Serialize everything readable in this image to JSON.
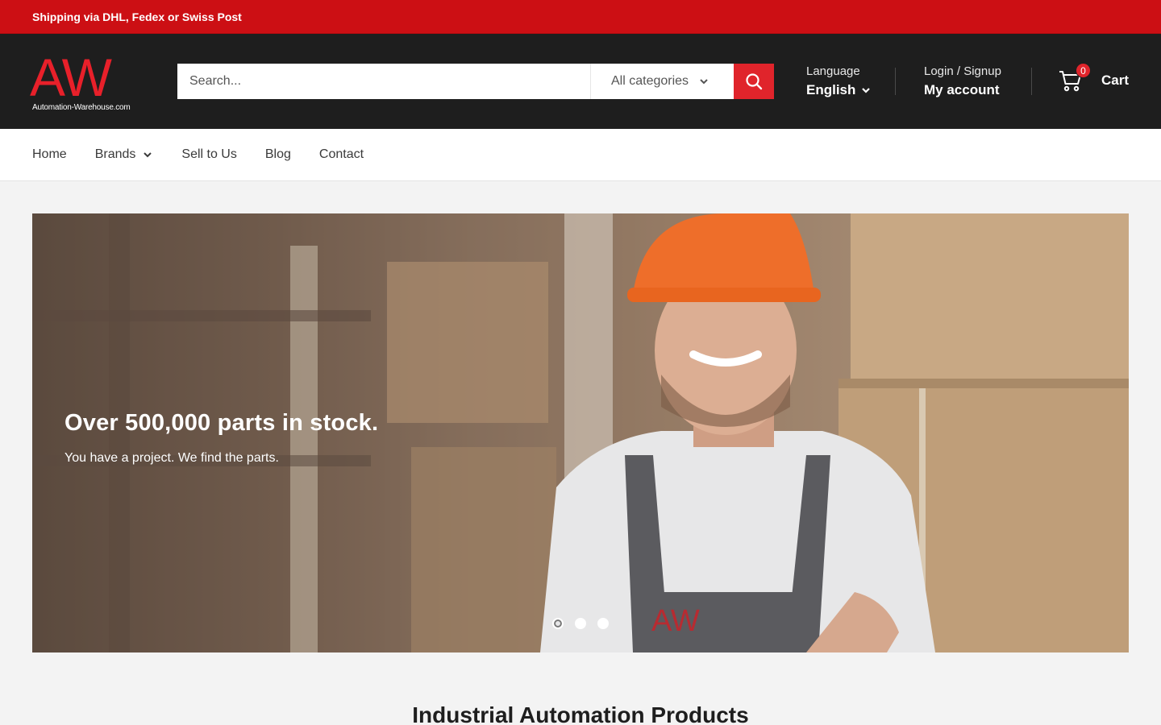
{
  "announcement": {
    "text": "Shipping via DHL, Fedex or Swiss Post"
  },
  "brand": {
    "letters": "AW",
    "tagline": "Automation-Warehouse.com",
    "accent": "#e8202a"
  },
  "search": {
    "placeholder": "Search...",
    "category": "All categories"
  },
  "language": {
    "label": "Language",
    "value": "English"
  },
  "account": {
    "label": "Login / Signup",
    "link": "My account"
  },
  "cart": {
    "count": "0",
    "label": "Cart"
  },
  "nav": {
    "home": "Home",
    "brands": "Brands",
    "sell": "Sell to Us",
    "blog": "Blog",
    "contact": "Contact"
  },
  "hero": {
    "title": "Over 500,000 parts in stock.",
    "subtitle": "You have a project. We find the parts.",
    "overall_logo": "AW",
    "slides": 3
  },
  "section": {
    "title": "Industrial Automation Products"
  },
  "colors": {
    "topbar": "#cc0f14",
    "header": "#1e1e1e",
    "search_button": "#e0242b"
  }
}
